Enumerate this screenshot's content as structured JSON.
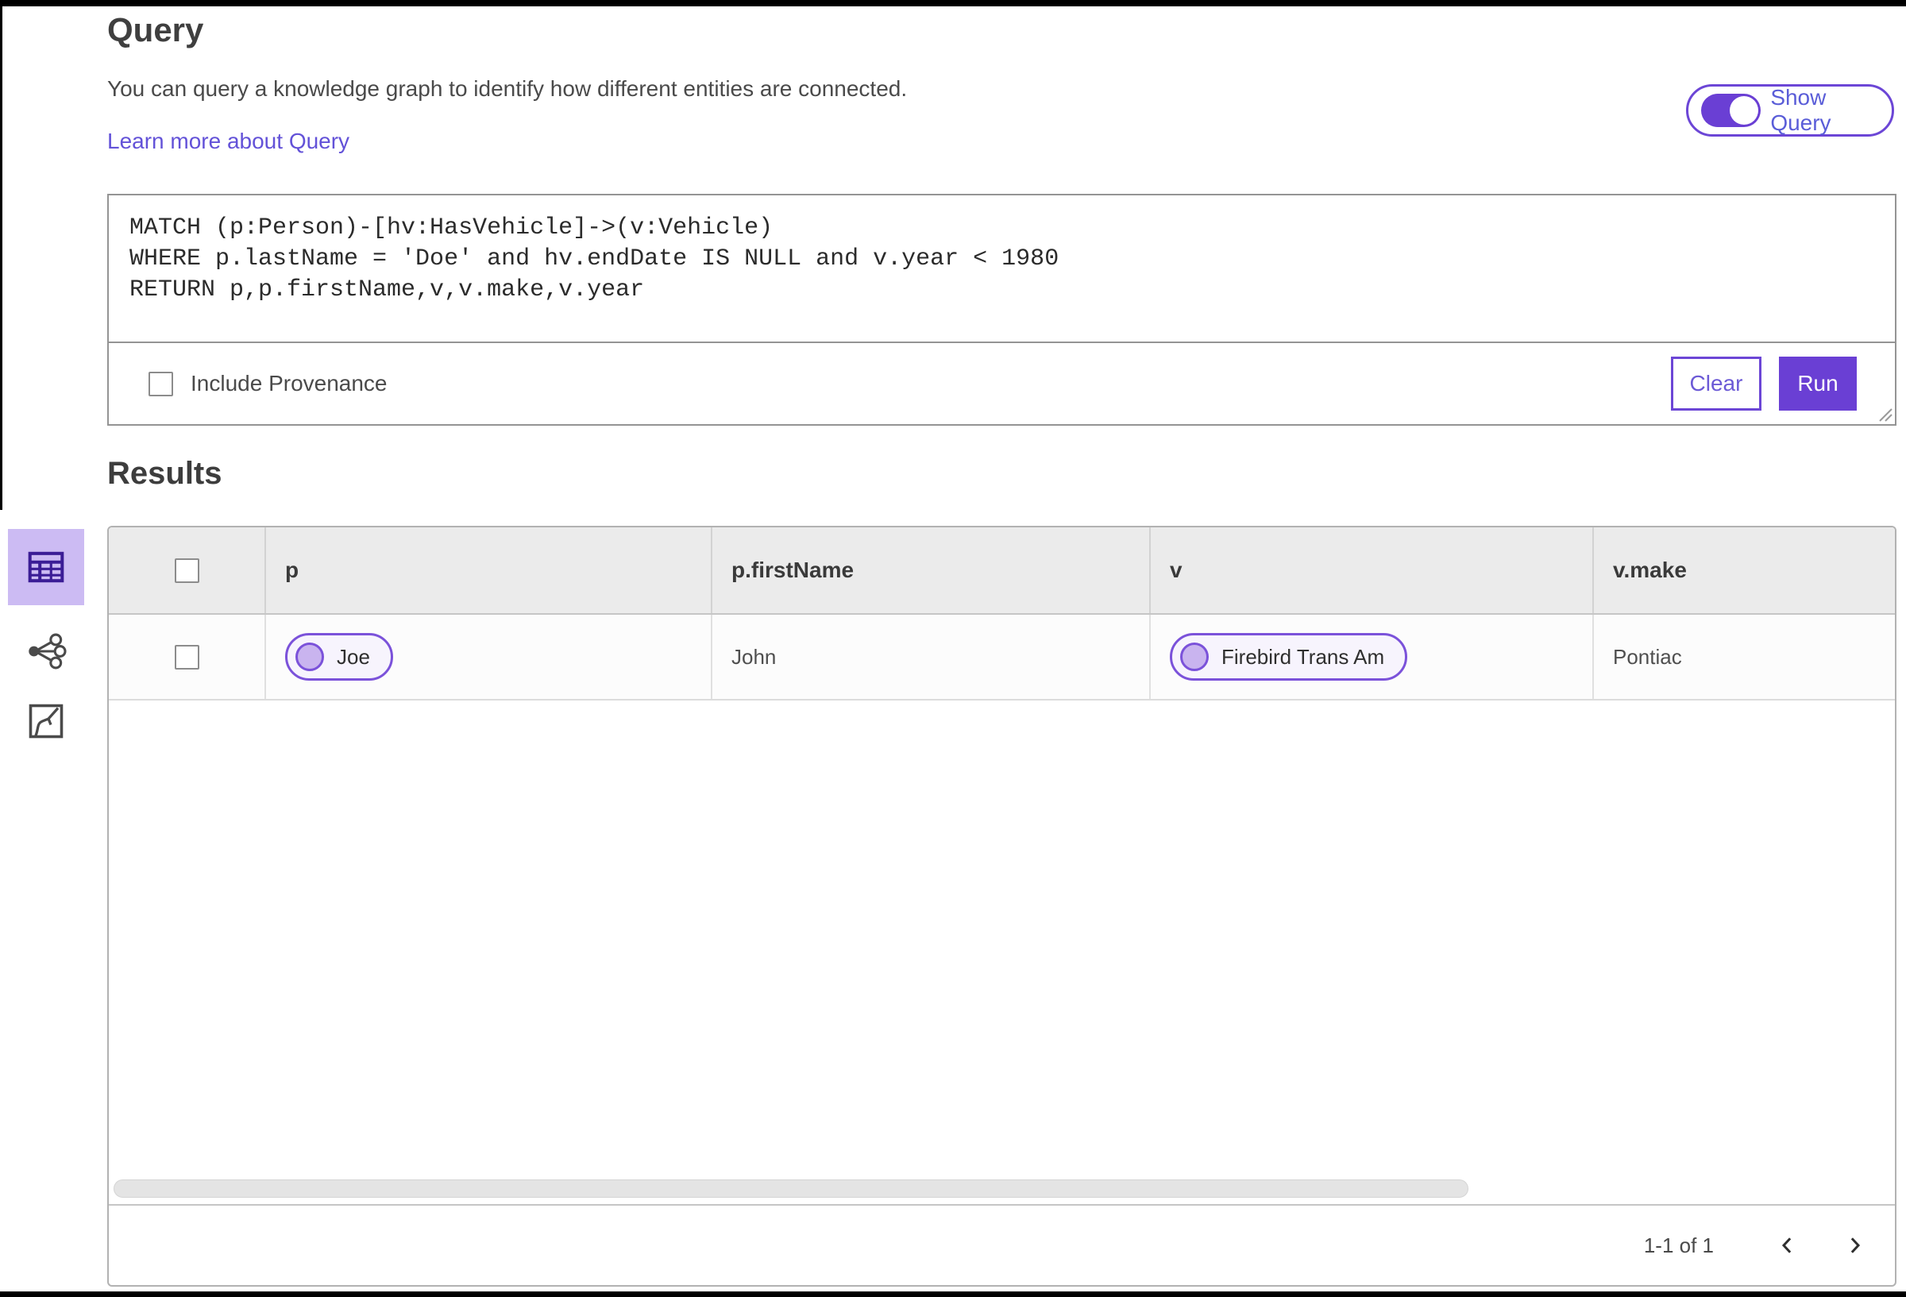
{
  "page": {
    "title": "Query",
    "description": "You can query a knowledge graph to identify how different entities are connected.",
    "learn_more_label": "Learn more about Query",
    "results_title": "Results"
  },
  "show_query_toggle": {
    "label": "Show Query",
    "state": "on"
  },
  "query_editor": {
    "code": "MATCH (p:Person)-[hv:HasVehicle]->(v:Vehicle)\nWHERE p.lastName = 'Doe' and hv.endDate IS NULL and v.year < 1980\nRETURN p,p.firstName,v,v.make,v.year",
    "include_provenance_label": "Include Provenance",
    "include_provenance_checked": false,
    "clear_label": "Clear",
    "run_label": "Run"
  },
  "view_switcher": {
    "items": [
      {
        "name": "table-view",
        "icon": "table-icon",
        "selected": true
      },
      {
        "name": "graph-view",
        "icon": "network-icon",
        "selected": false
      },
      {
        "name": "map-view",
        "icon": "map-icon",
        "selected": false
      }
    ]
  },
  "results_table": {
    "columns": [
      "p",
      "p.firstName",
      "v",
      "v.make"
    ],
    "rows": [
      {
        "p": {
          "type": "entity-chip",
          "label": "Joe"
        },
        "p_firstName": "John",
        "v": {
          "type": "entity-chip",
          "label": "Firebird Trans Am"
        },
        "v_make": "Pontiac"
      }
    ],
    "pagination": {
      "range_label": "1-1 of 1"
    }
  },
  "colors": {
    "accent_purple": "#6a3fd4",
    "chip_border": "#7b52da",
    "chip_background": "#f7f4fd",
    "selected_view_background": "#ccbbf3",
    "selected_view_icon": "#3b1d96",
    "link": "#6352d8",
    "header_background": "#ebebeb"
  }
}
